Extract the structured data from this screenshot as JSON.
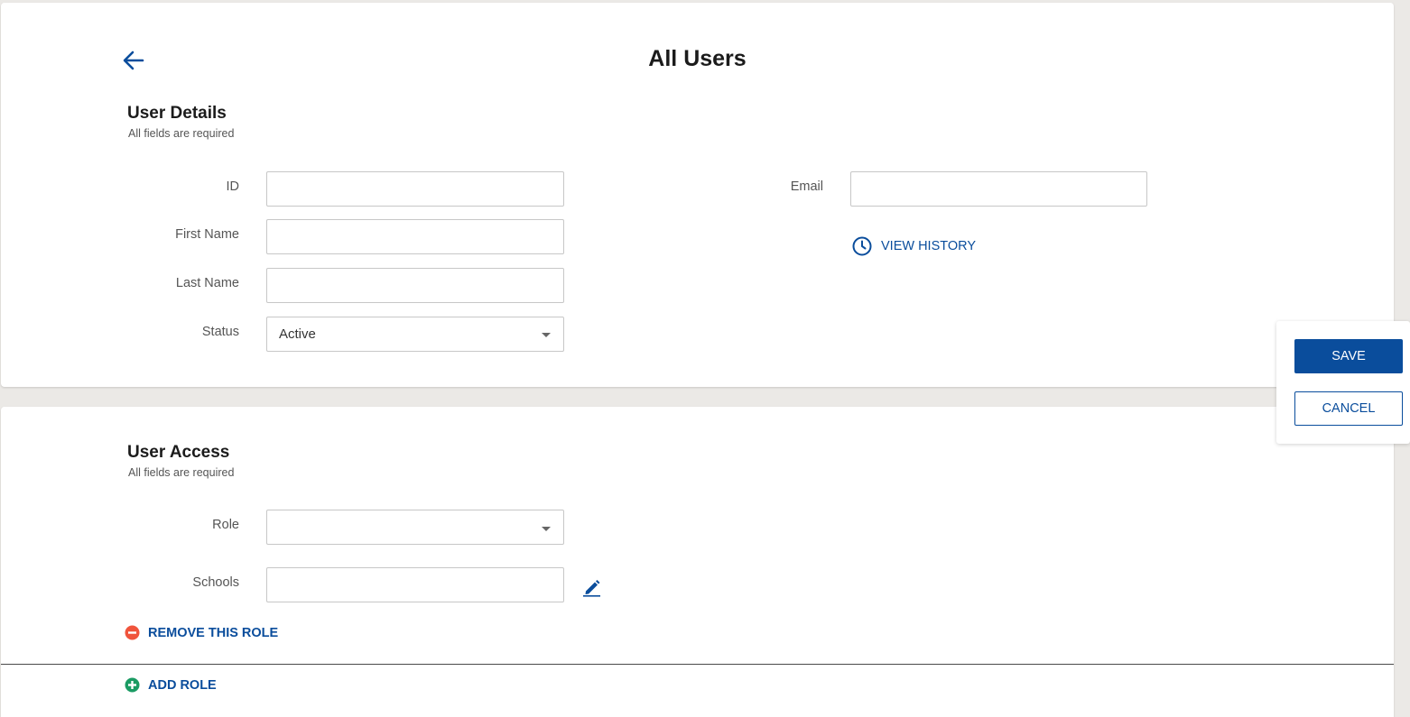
{
  "header": {
    "title": "All Users",
    "back_icon": "arrow-left-icon"
  },
  "user_details": {
    "title": "User Details",
    "subtitle": "All fields are required",
    "fields": {
      "id": {
        "label": "ID",
        "value": "",
        "placeholder": ""
      },
      "first_name": {
        "label": "First Name",
        "value": "",
        "placeholder": ""
      },
      "last_name": {
        "label": "Last Name",
        "value": "",
        "placeholder": ""
      },
      "status": {
        "label": "Status",
        "value": "Active"
      },
      "email": {
        "label": "Email",
        "value": "",
        "placeholder": ""
      }
    },
    "view_history_label": "VIEW HISTORY",
    "view_history_icon": "clock-icon"
  },
  "user_access": {
    "title": "User Access",
    "subtitle": "All fields are required",
    "fields": {
      "role": {
        "label": "Role",
        "value": ""
      },
      "schools": {
        "label": "Schools",
        "value": "",
        "placeholder": ""
      }
    },
    "edit_icon": "pencil-icon",
    "remove_role_label": "REMOVE THIS ROLE",
    "add_role_label": "ADD ROLE"
  },
  "actions": {
    "save_label": "SAVE",
    "cancel_label": "CANCEL"
  },
  "colors": {
    "accent": "#0a4d9c",
    "remove": "#f0543c",
    "add": "#1a9b63",
    "background": "#ebe9e6"
  }
}
